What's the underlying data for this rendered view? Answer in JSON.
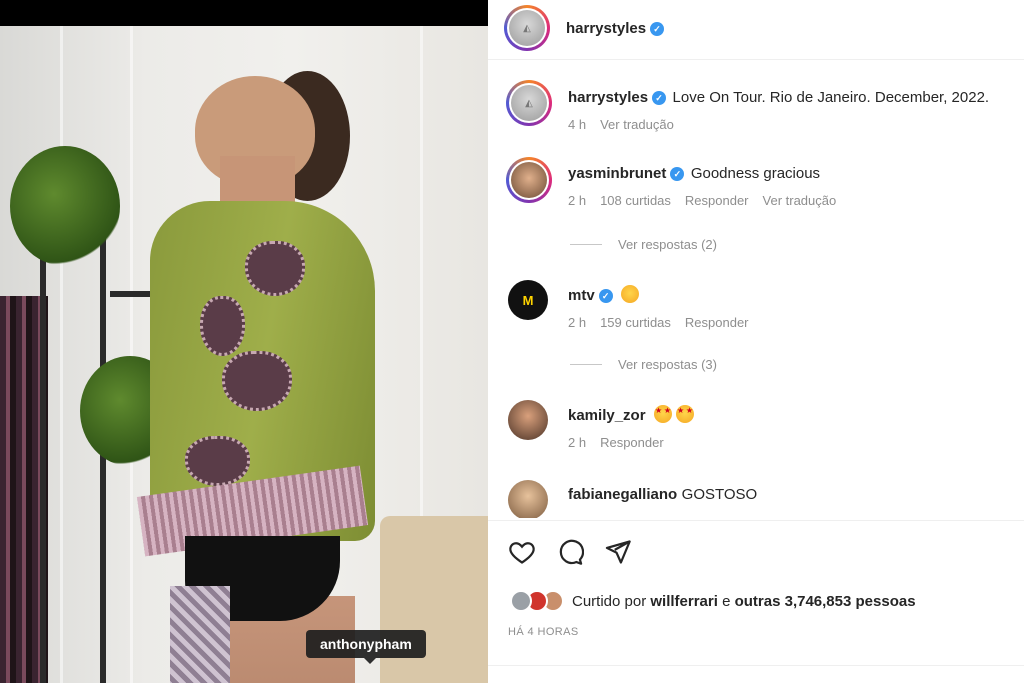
{
  "photo": {
    "tag_label": "anthonypham"
  },
  "header": {
    "username": "harrystyles"
  },
  "caption": {
    "username": "harrystyles",
    "text": "Love On Tour. Rio de Janeiro. December, 2022.",
    "time": "4 h",
    "translate": "Ver tradução"
  },
  "comments": [
    {
      "username": "yasminbrunet",
      "verified": true,
      "text": "Goodness gracious",
      "time": "2 h",
      "likes": "108 curtidas",
      "reply": "Responder",
      "translate": "Ver tradução",
      "view_replies": "Ver respostas (2)"
    },
    {
      "username": "mtv",
      "verified": true,
      "text": "",
      "emoji": "smiling-face",
      "logo_text": "M",
      "time": "2 h",
      "likes": "159 curtidas",
      "reply": "Responder",
      "view_replies": "Ver respostas (3)"
    },
    {
      "username": "kamily_zor",
      "verified": false,
      "emoji": "star-struck x2",
      "time": "2 h",
      "reply": "Responder"
    },
    {
      "username": "fabianegalliano",
      "verified": false,
      "text": "GOSTOSO"
    }
  ],
  "likes_bar": {
    "prefix": "Curtido por",
    "liker": "willferrari",
    "connector": "e",
    "others": "outras 3,746,853 pessoas"
  },
  "time_ago": "HÁ 4 HORAS",
  "colors": {
    "verified": "#3897f0",
    "muted": "#8e8e8e",
    "text": "#262626"
  }
}
